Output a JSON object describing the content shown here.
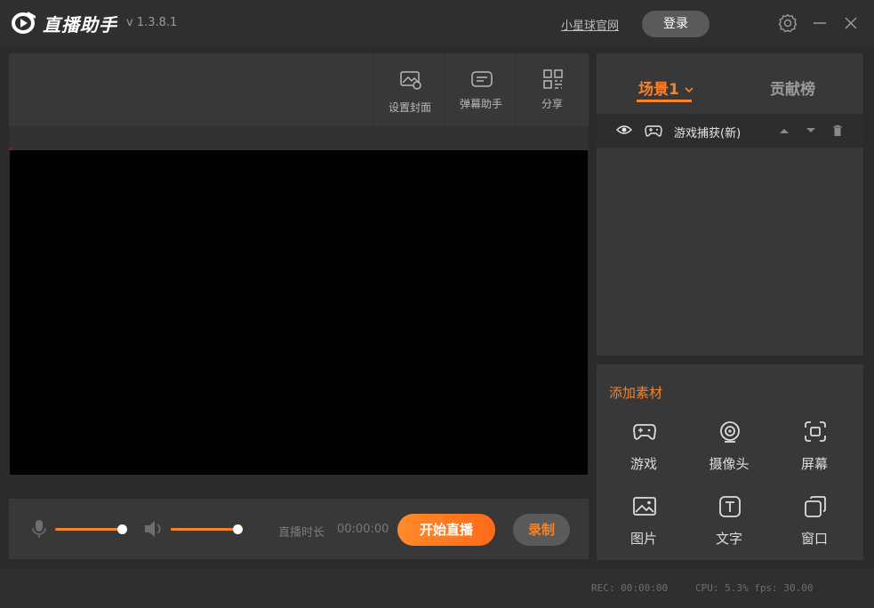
{
  "titlebar": {
    "app_name": "直播助手",
    "version": "v 1.3.8.1",
    "site_link": "小星球官网",
    "login_label": "登录",
    "icons": [
      "settings-icon",
      "minimize-icon",
      "close-icon"
    ]
  },
  "toolbar": {
    "items": [
      {
        "label": "设置封面",
        "icon": "cover-image-icon"
      },
      {
        "label": "弹幕助手",
        "icon": "danmaku-icon"
      },
      {
        "label": "分享",
        "icon": "qr-share-icon"
      }
    ]
  },
  "controls": {
    "mic_level": 1.0,
    "speaker_level": 1.0,
    "duration_label": "直播时长",
    "duration_value": "00:00:00",
    "start_label": "开始直播",
    "record_label": "录制"
  },
  "status": {
    "rec": "REC: 00:00:00",
    "cpu": "CPU: 5.3% fps: 30.00"
  },
  "scenes": {
    "active_tab": "场景1",
    "other_tab": "贡献榜",
    "sources": [
      {
        "name": "游戏捕获(新)"
      }
    ]
  },
  "assets": {
    "title": "添加素材",
    "items": [
      {
        "label": "游戏",
        "icon": "gamepad-icon"
      },
      {
        "label": "摄像头",
        "icon": "camera-icon"
      },
      {
        "label": "屏幕",
        "icon": "screen-capture-icon"
      },
      {
        "label": "图片",
        "icon": "image-icon"
      },
      {
        "label": "文字",
        "icon": "text-icon"
      },
      {
        "label": "窗口",
        "icon": "window-icon"
      }
    ]
  },
  "colors": {
    "accent": "#f7822a",
    "background": "#2b2b2b",
    "panel": "#383838"
  }
}
